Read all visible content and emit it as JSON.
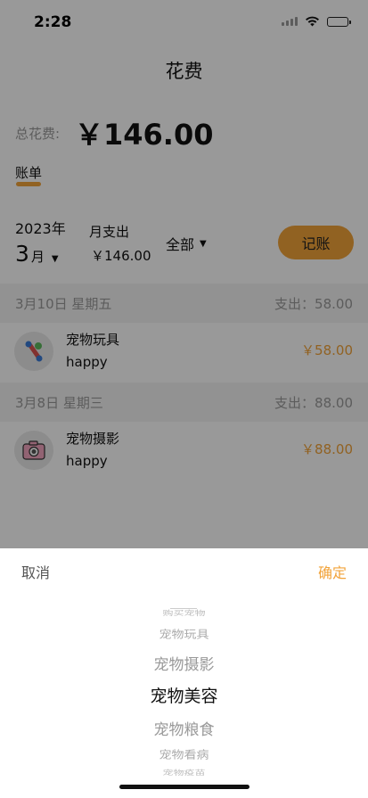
{
  "status_bar": {
    "time": "2:28"
  },
  "nav": {
    "title": "花费"
  },
  "summary_total": {
    "label": "总花费:",
    "value": "￥146.00"
  },
  "tabs": {
    "bill_label": "账单"
  },
  "month_summary": {
    "year": "2023年",
    "month": "3",
    "month_unit": "月",
    "spend_label": "月支出",
    "spend_value": "￥146.00",
    "filter_label": "全部",
    "record_button": "记账"
  },
  "groups": [
    {
      "date": "3月10日 星期五",
      "total": "支出：58.00",
      "entries": [
        {
          "icon": "pet-toy-icon",
          "name": "宠物玩具",
          "note": "happy",
          "amount": "￥58.00"
        }
      ]
    },
    {
      "date": "3月8日 星期三",
      "total": "支出：88.00",
      "entries": [
        {
          "icon": "camera-icon",
          "name": "宠物摄影",
          "note": "happy",
          "amount": "￥88.00"
        }
      ]
    }
  ],
  "picker_sheet": {
    "cancel_label": "取消",
    "confirm_label": "确定",
    "options": [
      "购买宠物",
      "宠物玩具",
      "宠物摄影",
      "宠物美容",
      "宠物粮食",
      "宠物看病",
      "宠物疫苗"
    ],
    "selected": "宠物美容"
  },
  "colors": {
    "accent": "#f2a33a",
    "muted_text": "#9a9a9a",
    "overlay": "rgba(0,0,0,0.4)"
  }
}
